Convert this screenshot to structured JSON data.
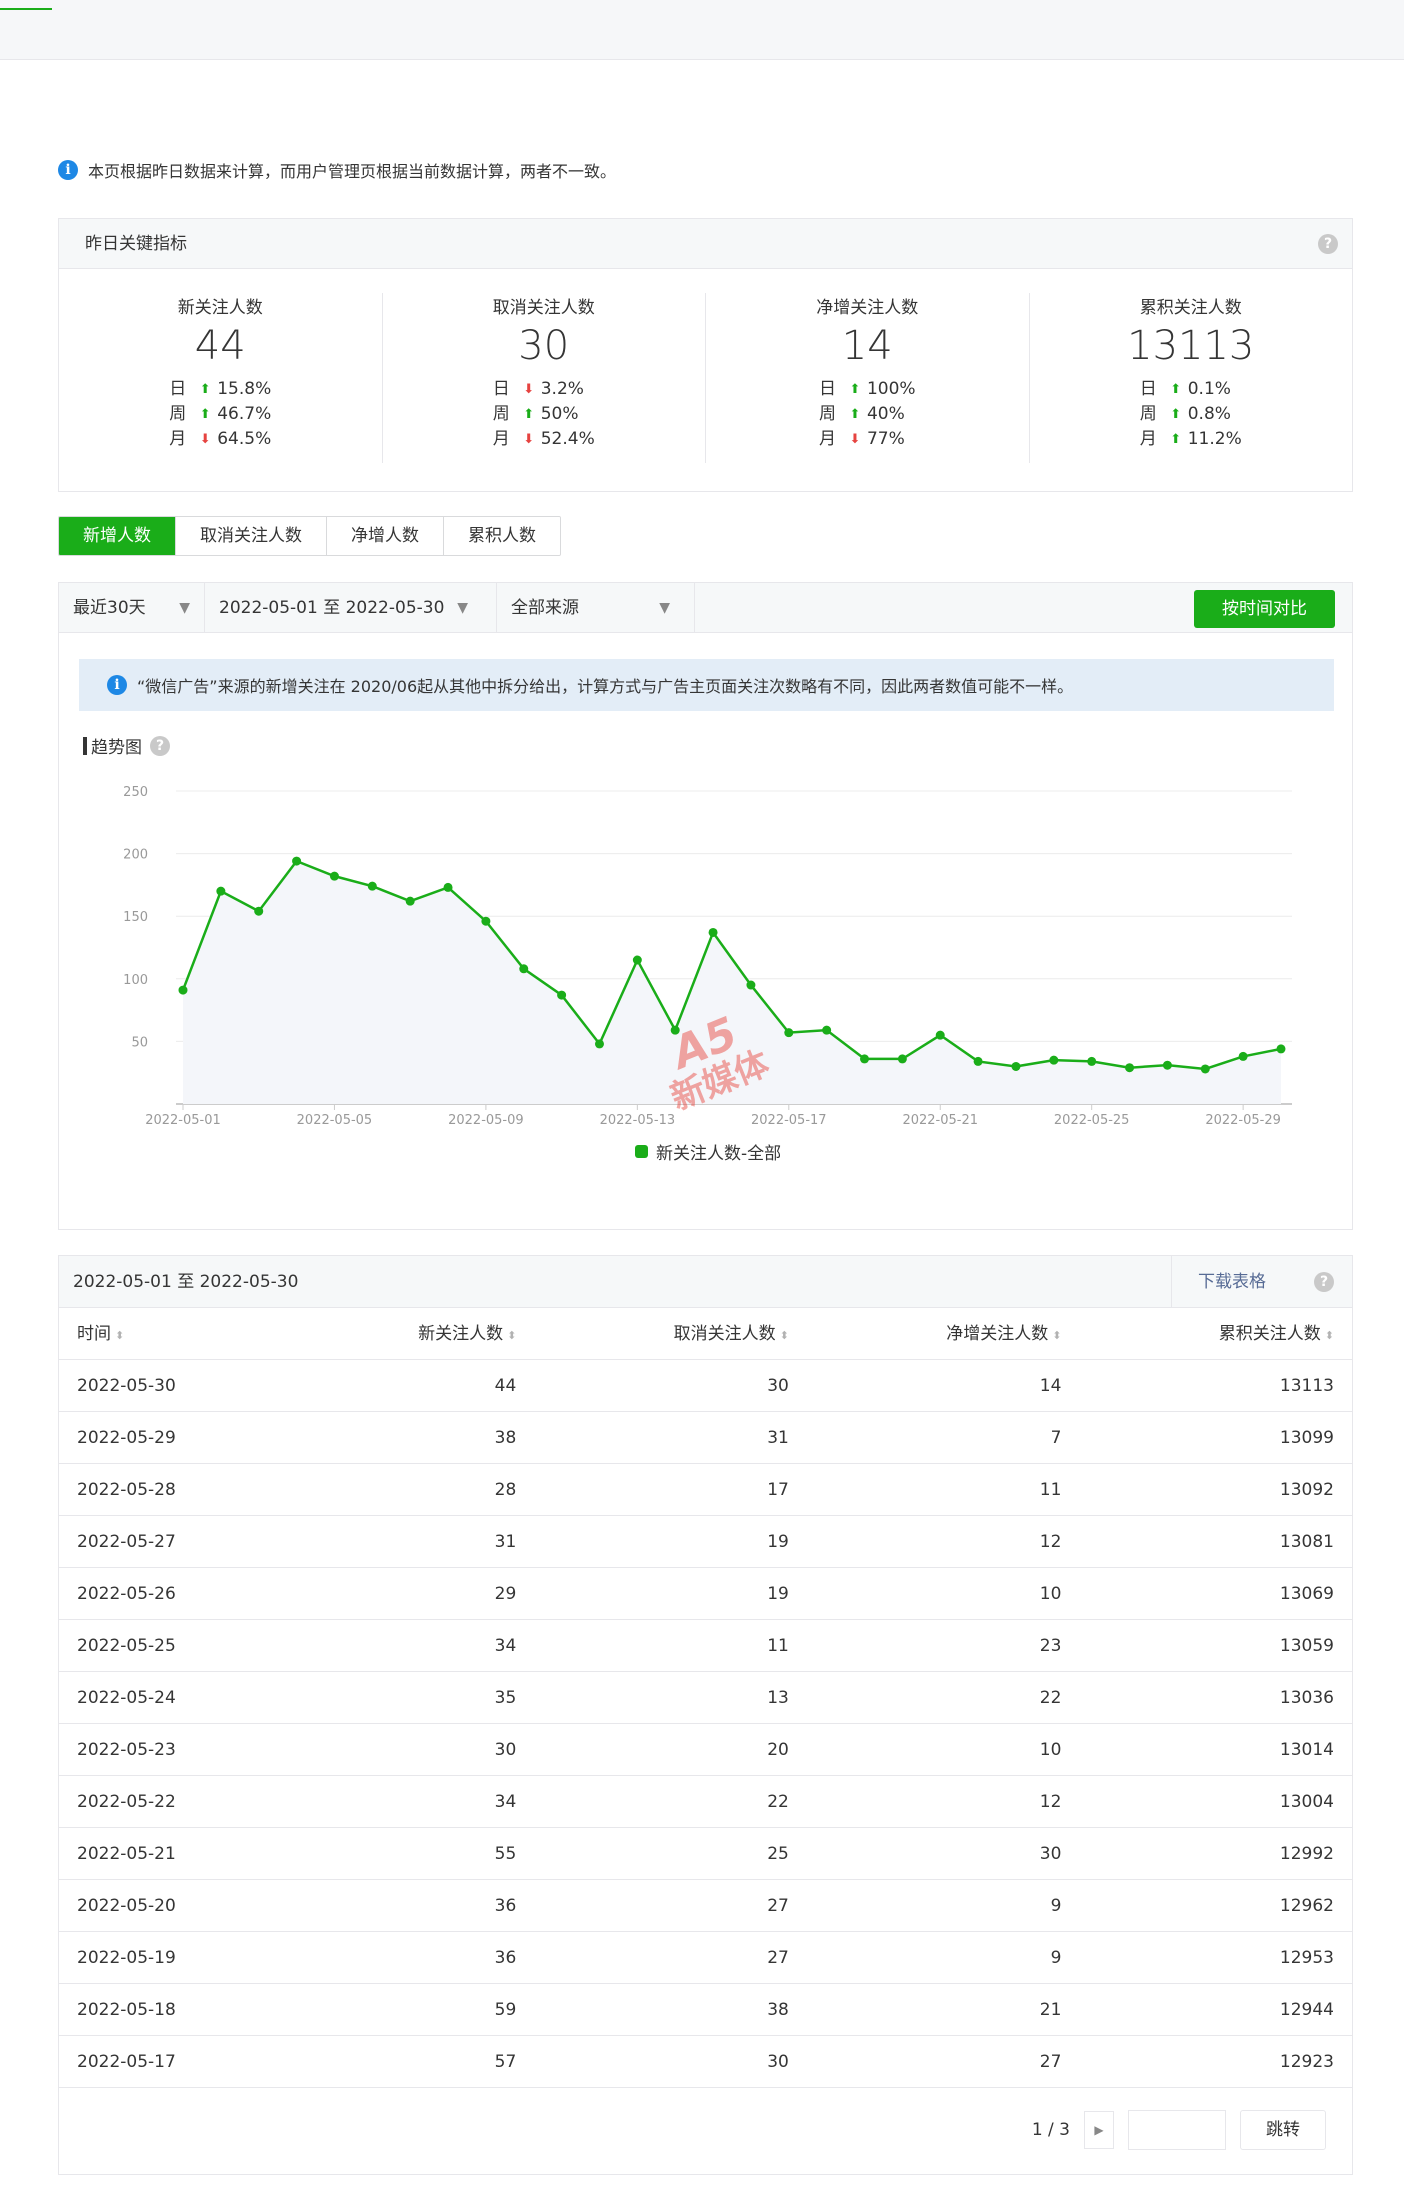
{
  "notice": "本页根据昨日数据来计算，而用户管理页根据当前数据计算，两者不一致。",
  "kpi": {
    "header": "昨日关键指标",
    "period_labels": [
      "日",
      "周",
      "月"
    ],
    "items": [
      {
        "title": "新关注人数",
        "value": "44",
        "stats": [
          {
            "dir": "up",
            "pct": "15.8%"
          },
          {
            "dir": "up",
            "pct": "46.7%"
          },
          {
            "dir": "down",
            "pct": "64.5%"
          }
        ]
      },
      {
        "title": "取消关注人数",
        "value": "30",
        "stats": [
          {
            "dir": "down",
            "pct": "3.2%"
          },
          {
            "dir": "up",
            "pct": "50%"
          },
          {
            "dir": "down",
            "pct": "52.4%"
          }
        ]
      },
      {
        "title": "净增关注人数",
        "value": "14",
        "stats": [
          {
            "dir": "up",
            "pct": "100%"
          },
          {
            "dir": "up",
            "pct": "40%"
          },
          {
            "dir": "down",
            "pct": "77%"
          }
        ]
      },
      {
        "title": "累积关注人数",
        "value": "13113",
        "stats": [
          {
            "dir": "up",
            "pct": "0.1%"
          },
          {
            "dir": "up",
            "pct": "0.8%"
          },
          {
            "dir": "up",
            "pct": "11.2%"
          }
        ]
      }
    ]
  },
  "tabs": [
    {
      "label": "新增人数",
      "active": true
    },
    {
      "label": "取消关注人数",
      "active": false
    },
    {
      "label": "净增人数",
      "active": false
    },
    {
      "label": "累积人数",
      "active": false
    }
  ],
  "filters": {
    "range": "最近30天",
    "dates": "2022-05-01 至 2022-05-30",
    "source": "全部来源",
    "compare_button": "按时间对比"
  },
  "blue_note": "“微信广告”来源的新增关注在 2020/06起从其他中拆分给出，计算方式与广告主页面关注次数略有不同，因此两者数值可能不一样。",
  "trend_title": "趋势图",
  "watermark": {
    "line1": "A5",
    "line2": "新媒体"
  },
  "chart_data": {
    "type": "line",
    "x": [
      "2022-05-01",
      "2022-05-02",
      "2022-05-03",
      "2022-05-04",
      "2022-05-05",
      "2022-05-06",
      "2022-05-07",
      "2022-05-08",
      "2022-05-09",
      "2022-05-10",
      "2022-05-11",
      "2022-05-12",
      "2022-05-13",
      "2022-05-14",
      "2022-05-15",
      "2022-05-16",
      "2022-05-17",
      "2022-05-18",
      "2022-05-19",
      "2022-05-20",
      "2022-05-21",
      "2022-05-22",
      "2022-05-23",
      "2022-05-24",
      "2022-05-25",
      "2022-05-26",
      "2022-05-27",
      "2022-05-28",
      "2022-05-29",
      "2022-05-30"
    ],
    "x_tick_labels": [
      "2022-05-01",
      "2022-05-05",
      "2022-05-09",
      "2022-05-13",
      "2022-05-17",
      "2022-05-21",
      "2022-05-25",
      "2022-05-29"
    ],
    "series": [
      {
        "name": "新关注人数-全部",
        "color": "#1aad19",
        "values": [
          91,
          170,
          154,
          194,
          182,
          174,
          162,
          173,
          146,
          108,
          87,
          48,
          115,
          59,
          137,
          95,
          57,
          59,
          36,
          36,
          55,
          34,
          30,
          35,
          34,
          29,
          31,
          28,
          38,
          44
        ]
      }
    ],
    "y_ticks": [
      50,
      100,
      150,
      200,
      250
    ],
    "ylim": [
      0,
      250
    ],
    "grid": true,
    "legend_position": "bottom"
  },
  "table": {
    "range_label": "2022-05-01 至 2022-05-30",
    "download": "下载表格",
    "headers": [
      "时间",
      "新关注人数",
      "取消关注人数",
      "净增关注人数",
      "累积关注人数"
    ],
    "rows": [
      [
        "2022-05-30",
        "44",
        "30",
        "14",
        "13113"
      ],
      [
        "2022-05-29",
        "38",
        "31",
        "7",
        "13099"
      ],
      [
        "2022-05-28",
        "28",
        "17",
        "11",
        "13092"
      ],
      [
        "2022-05-27",
        "31",
        "19",
        "12",
        "13081"
      ],
      [
        "2022-05-26",
        "29",
        "19",
        "10",
        "13069"
      ],
      [
        "2022-05-25",
        "34",
        "11",
        "23",
        "13059"
      ],
      [
        "2022-05-24",
        "35",
        "13",
        "22",
        "13036"
      ],
      [
        "2022-05-23",
        "30",
        "20",
        "10",
        "13014"
      ],
      [
        "2022-05-22",
        "34",
        "22",
        "12",
        "13004"
      ],
      [
        "2022-05-21",
        "55",
        "25",
        "30",
        "12992"
      ],
      [
        "2022-05-20",
        "36",
        "27",
        "9",
        "12962"
      ],
      [
        "2022-05-19",
        "36",
        "27",
        "9",
        "12953"
      ],
      [
        "2022-05-18",
        "59",
        "38",
        "21",
        "12944"
      ],
      [
        "2022-05-17",
        "57",
        "30",
        "27",
        "12923"
      ]
    ],
    "pager": {
      "page_text": "1 / 3",
      "jump_label": "跳转"
    }
  }
}
